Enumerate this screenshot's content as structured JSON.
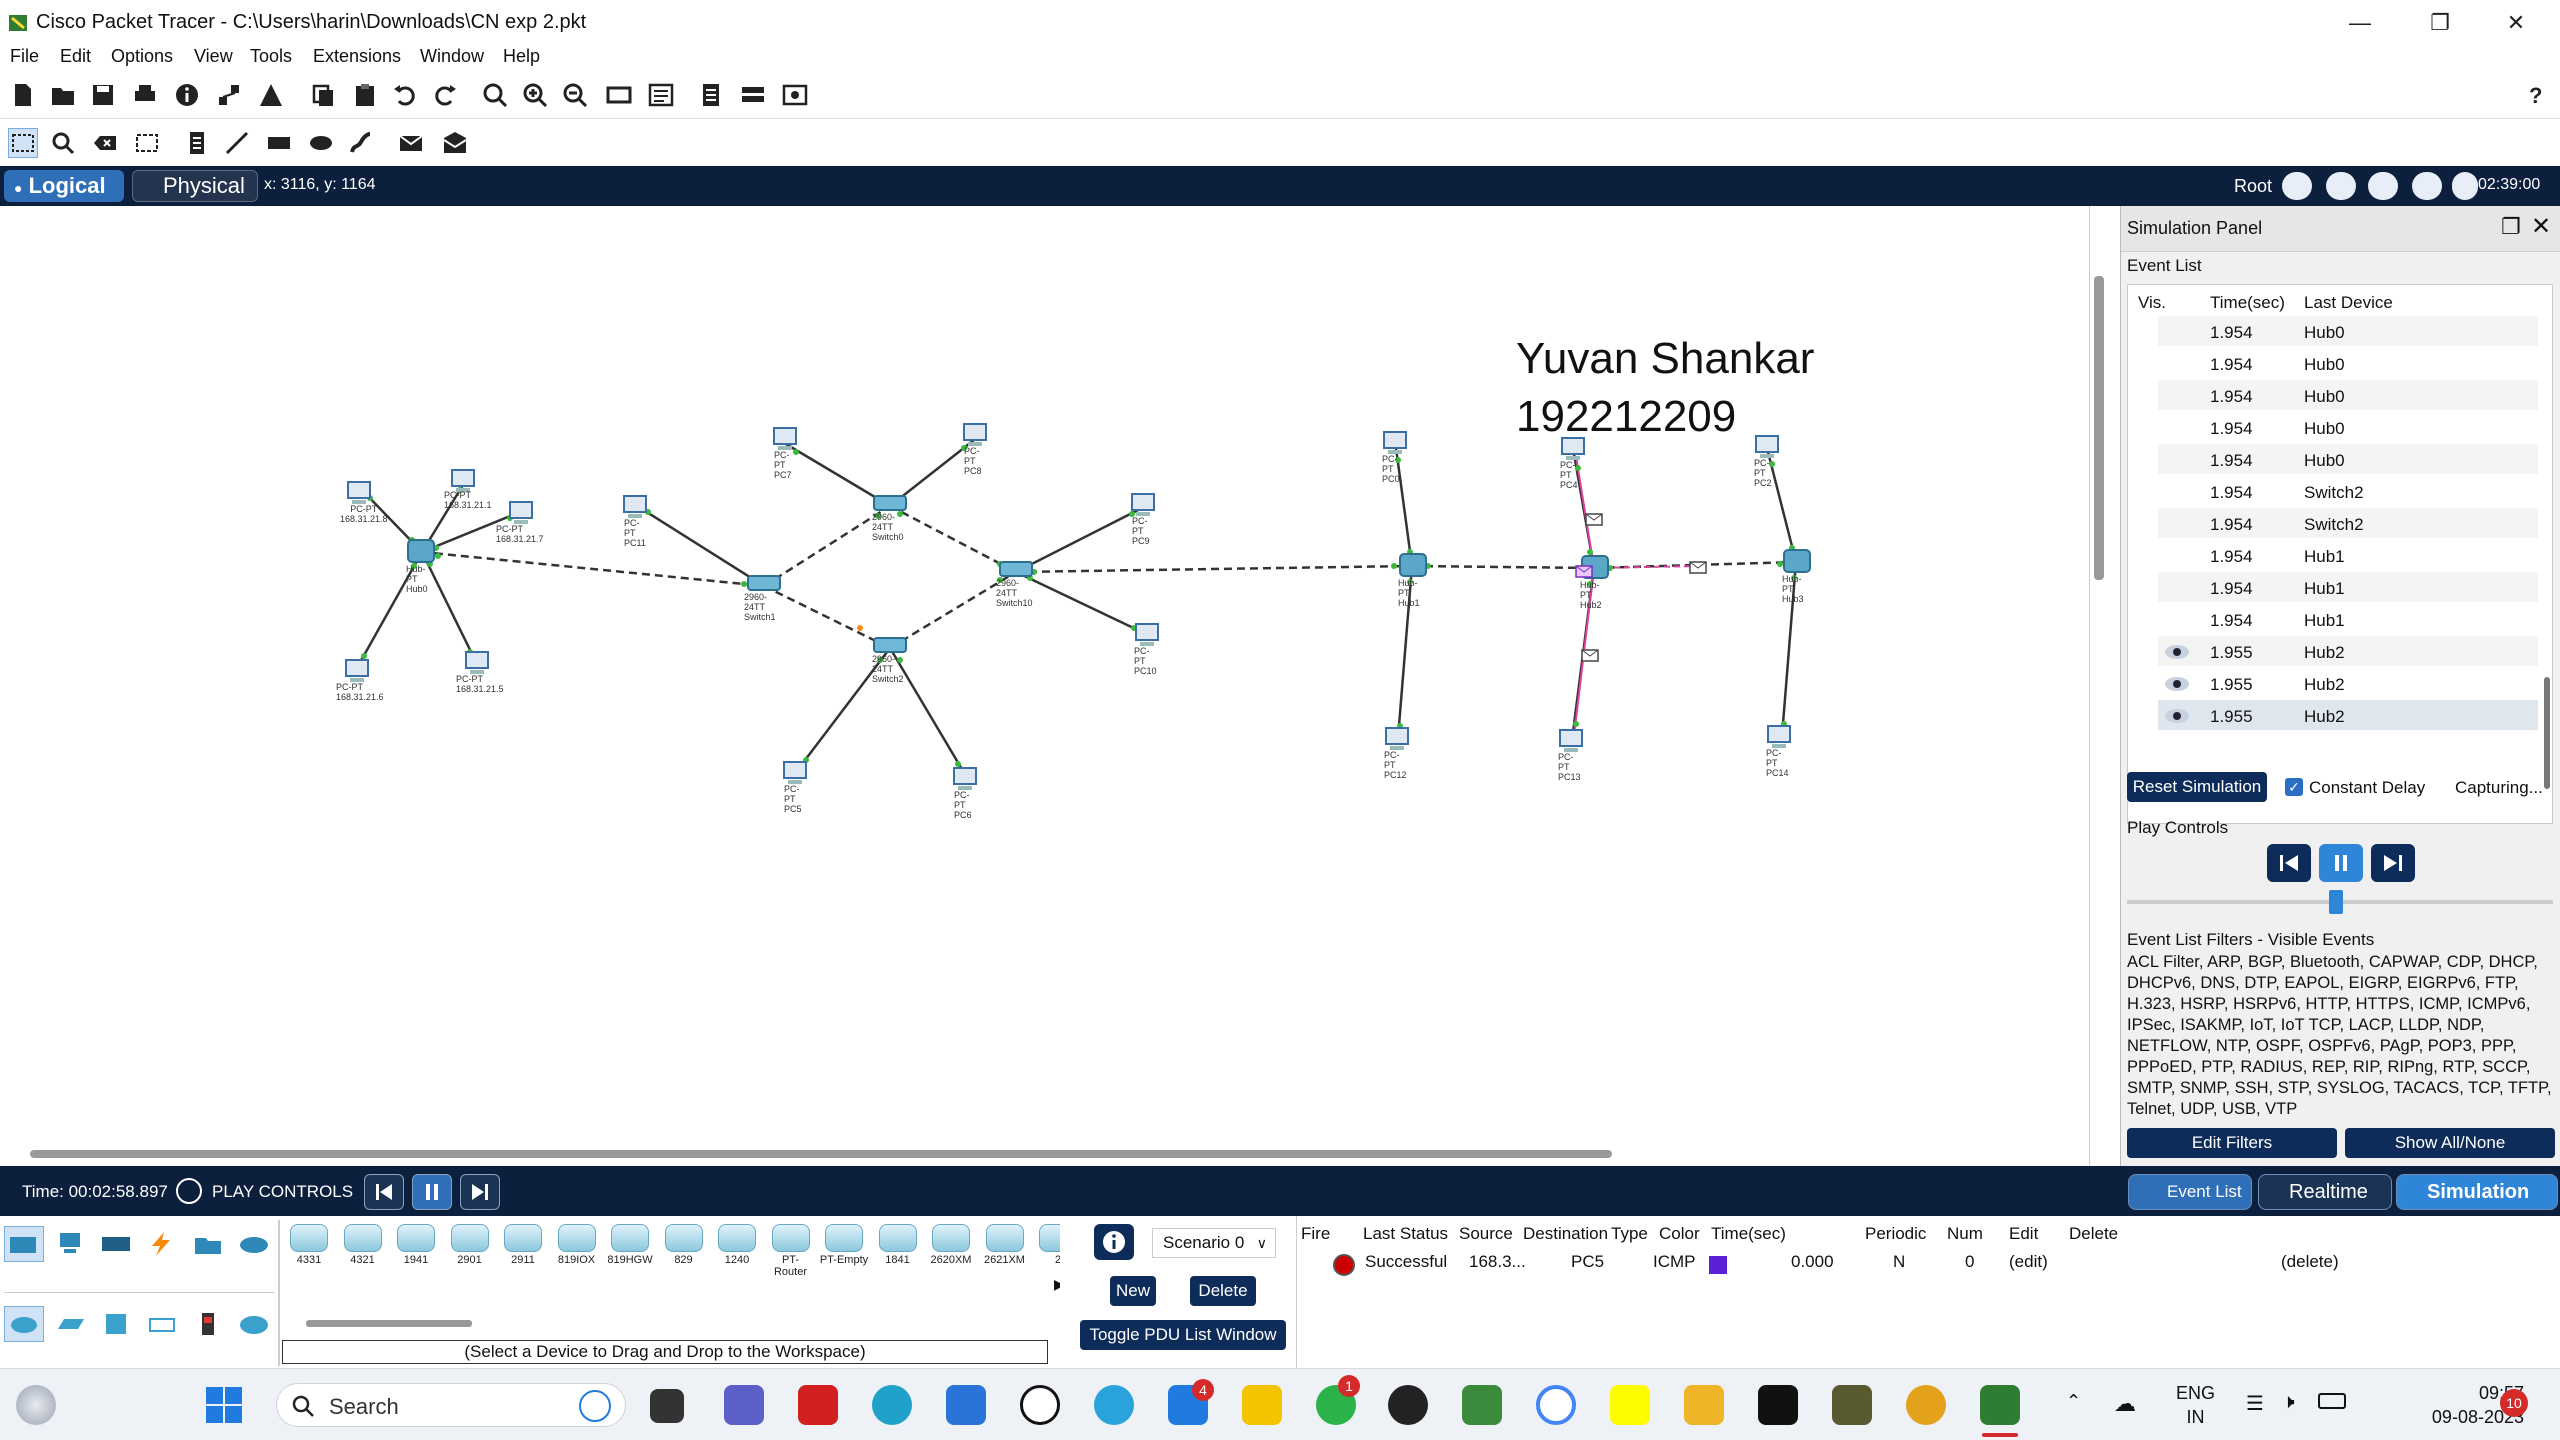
{
  "window": {
    "title": "Cisco Packet Tracer - C:\\Users\\harin\\Downloads\\CN exp 2.pkt"
  },
  "menu": [
    "File",
    "Edit",
    "Options",
    "View",
    "Tools",
    "Extensions",
    "Window",
    "Help"
  ],
  "view_bar": {
    "logical_label": "Logical",
    "physical_label": "Physical",
    "coords": "x: 3116, y: 1164",
    "root_label": "Root",
    "clock": "02:39:00"
  },
  "workspace": {
    "annotation_name": "Yuvan Shankar",
    "annotation_id": "192212209",
    "device_labels": {
      "pc_tl1": [
        "PC-PT",
        "168.31.21.8"
      ],
      "pc_tl2": [
        "PC-PT",
        "168.31.21.1"
      ],
      "pc_tl3": [
        "PC-PT",
        "168.31.21.7"
      ],
      "pc_bl1": [
        "PC-PT",
        "168.31.21.6"
      ],
      "pc_bl2": [
        "PC-PT",
        "168.31.21.5"
      ],
      "hub_left": [
        "Hub-PT",
        "Hub0"
      ],
      "pc11": [
        "PC-PT",
        "PC11"
      ],
      "pc7": [
        "PC-PT",
        "PC7"
      ],
      "pc8": [
        "PC-PT",
        "PC8"
      ],
      "switch0": [
        "2960-24TT",
        "Switch0"
      ],
      "switch1": [
        "2960-24TT",
        "Switch1"
      ],
      "switch2": [
        "2960-24TT",
        "Switch2"
      ],
      "switch10": [
        "2960-24TT",
        "Switch10"
      ],
      "pc5": [
        "PC-PT",
        "PC5"
      ],
      "pc6": [
        "PC-PT",
        "PC6"
      ],
      "pc9": [
        "PC-PT",
        "PC9"
      ],
      "pc10": [
        "PC-PT",
        "PC10"
      ],
      "hub1": [
        "Hub-PT",
        "Hub1"
      ],
      "hub2": [
        "Hub-PT",
        "Hub2"
      ],
      "hub3": [
        "Hub-PT",
        "Hub3"
      ],
      "pc_a": [
        "PC-PT",
        "PC0"
      ],
      "pc_b": [
        "PC-PT",
        "PC4"
      ],
      "pc_c": [
        "PC-PT",
        "PC2"
      ],
      "pc12": [
        "PC-PT",
        "PC12"
      ],
      "pc13": [
        "PC-PT",
        "PC13"
      ],
      "pc14": [
        "PC-PT",
        "PC14"
      ]
    }
  },
  "simulation_panel": {
    "title": "Simulation Panel",
    "event_list_label": "Event List",
    "columns": [
      "Vis.",
      "Time(sec)",
      "Last Device"
    ],
    "events": [
      {
        "vis": false,
        "time": "1.954",
        "device": "Hub0"
      },
      {
        "vis": false,
        "time": "1.954",
        "device": "Hub0"
      },
      {
        "vis": false,
        "time": "1.954",
        "device": "Hub0"
      },
      {
        "vis": false,
        "time": "1.954",
        "device": "Hub0"
      },
      {
        "vis": false,
        "time": "1.954",
        "device": "Hub0"
      },
      {
        "vis": false,
        "time": "1.954",
        "device": "Switch2"
      },
      {
        "vis": false,
        "time": "1.954",
        "device": "Switch2"
      },
      {
        "vis": false,
        "time": "1.954",
        "device": "Hub1"
      },
      {
        "vis": false,
        "time": "1.954",
        "device": "Hub1"
      },
      {
        "vis": false,
        "time": "1.954",
        "device": "Hub1"
      },
      {
        "vis": true,
        "time": "1.955",
        "device": "Hub2"
      },
      {
        "vis": true,
        "time": "1.955",
        "device": "Hub2"
      },
      {
        "vis": true,
        "time": "1.955",
        "device": "Hub2"
      }
    ],
    "reset_label": "Reset Simulation",
    "constant_delay_label": "Constant Delay",
    "constant_delay_checked": true,
    "capturing_label": "Capturing...",
    "play_controls_label": "Play Controls",
    "filters_title": "Event List Filters - Visible Events",
    "filters_text": "ACL Filter, ARP, BGP, Bluetooth, CAPWAP, CDP, DHCP, DHCPv6, DNS, DTP, EAPOL, EIGRP, EIGRPv6, FTP, H.323, HSRP, HSRPv6, HTTP, HTTPS, ICMP, ICMPv6, IPSec, ISAKMP, IoT, IoT TCP, LACP, LLDP, NDP, NETFLOW, NTP, OSPF, OSPFv6, PAgP, POP3, PPP, PPPoED, PTP, RADIUS, REP, RIP, RIPng, RTP, SCCP, SMTP, SNMP, SSH, STP, SYSLOG, TACACS, TCP, TFTP, Telnet, UDP, USB, VTP",
    "edit_filters_label": "Edit Filters",
    "show_all_label": "Show All/None"
  },
  "time_bar": {
    "time": "Time: 00:02:58.897",
    "play_controls": "PLAY CONTROLS",
    "event_list_tab": "Event List",
    "realtime_tab": "Realtime",
    "simulation_tab": "Simulation"
  },
  "device_panel": {
    "devices": [
      "4331",
      "4321",
      "1941",
      "2901",
      "2911",
      "819IOX",
      "819HGW",
      "829",
      "1240",
      "PT-Router",
      "PT-Empty",
      "1841",
      "2620XM",
      "2621XM",
      "2"
    ],
    "hint": "(Select a Device to Drag and Drop to the Workspace)"
  },
  "pdu_controls": {
    "scenario": "Scenario 0",
    "new_label": "New",
    "delete_label": "Delete",
    "toggle_label": "Toggle PDU List Window"
  },
  "pdu_table": {
    "headers": [
      "Fire",
      "Last Status",
      "Source",
      "Destination",
      "Type",
      "Color",
      "Time(sec)",
      "Periodic",
      "Num",
      "Edit",
      "Delete"
    ],
    "rows": [
      {
        "status": "Successful",
        "source": "168.3...",
        "destination": "PC5",
        "type": "ICMP",
        "color": "#5b1fd6",
        "time": "0.000",
        "periodic": "N",
        "num": "0",
        "edit": "(edit)",
        "delete": "(delete)"
      }
    ]
  },
  "taskbar": {
    "search_label": "Search",
    "mail_badge": "4",
    "whatsapp_badge": "1",
    "lang_1": "ENG",
    "lang_2": "IN",
    "time": "09:57",
    "date": "09-08-2023",
    "notif_count": "10"
  }
}
